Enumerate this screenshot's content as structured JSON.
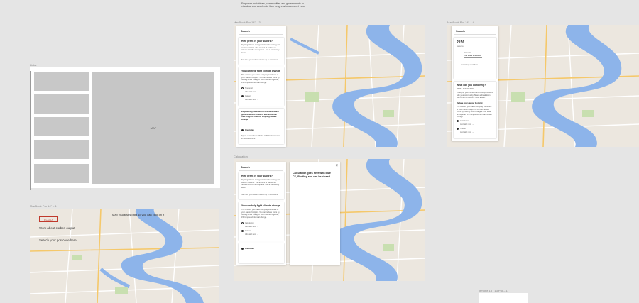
{
  "notes": {
    "top_note": "Empower individuals, communities and governments to visualise and accelerate their progress towards net zero",
    "wireframe_label": "Links",
    "map_placeholder": "MAP",
    "frame_bottom_left": "MacBook Pro 14\" – 1",
    "frame_top_middle": "MacBook Pro 14\" – 3",
    "frame_top_right": "MacBook Pro 14\" – 4",
    "frame_middle": "Calculation",
    "frame_bottom_right": "iPhone 13 / 13 Pro – 1",
    "map_callout": "Map visualises data so you can click on it"
  },
  "landing": {
    "logo": "LOGO",
    "work_about": "Work about carbon output",
    "search_postcode": "Search your postcode here"
  },
  "panel_a": {
    "search": "Search",
    "card1_title": "How green is your suburb?",
    "card1_text": "Fighting climate change starts with meeting net carbon footprint. The amount of carbon we release into the atmosphere – on a community level.",
    "card1_link": "See how your suburb stacks up in emissions",
    "card2_title": "You can help fight climate change",
    "card2_text": "The choices you make everyday contribute to your carbon footprint. You can reduce yours by making small changes. And if we act together, it'll compound into real change.",
    "opt1": "Transport",
    "opt1_link": "Add alert now →",
    "opt2": "Gather",
    "opt2_link": "Add alert now →",
    "card3_title": "Empowering individuals, communities and governments to visualise and accelerate their progress towards stopping climate change",
    "card3_opt": "Greenstep",
    "card3_text": "Space out the best with the HPR for local action in Australia 2023."
  },
  "panel_b": {
    "search": "Search",
    "big_number": "2156",
    "unit": "Suburbs",
    "field1": "Postcode",
    "field2": "Tree tree's emissions",
    "action": "something went here",
    "card_title": "What can you do to help?",
    "sub1": "Start a conversation",
    "sub1_text": "Changing your current carbon footprint starts with your community. Share a breakdown with others to become more aware.",
    "sub2": "Reduce your carbon footprint",
    "sub2_text": "The choices you make everyday contribute to your carbon footprint. You can reduce yours by making small changes. And if we act together, it'll compound into real climate change.",
    "opt1": "Calculation",
    "opt1_link": "Add alert now →",
    "opt2": "Transit",
    "opt2_link": "Add alert now →"
  },
  "panel_c": {
    "search": "Search",
    "card1_title": "How green is your suburb?",
    "card1_text": "Fighting climate change starts with meeting net carbon footprint. The amount of carbon we release into the atmosphere – on a community level.",
    "card1_link": "See how your suburb stacks up in emissions",
    "card2_title": "You can help fight climate change",
    "card2_text": "The choices you make everyday contribute to your carbon footprint. You can reduce yours by making small changes. And if we act together, it'll compound into real change.",
    "opt1": "Calculation",
    "opt1_link": "Add alert now →",
    "opt2": "Gather",
    "opt2_link": "Add alert now →",
    "card3_opt": "Greenstep"
  },
  "modal": {
    "title": "Calculation goes here with blue CK, Roofing and can be closed",
    "close": "×"
  }
}
